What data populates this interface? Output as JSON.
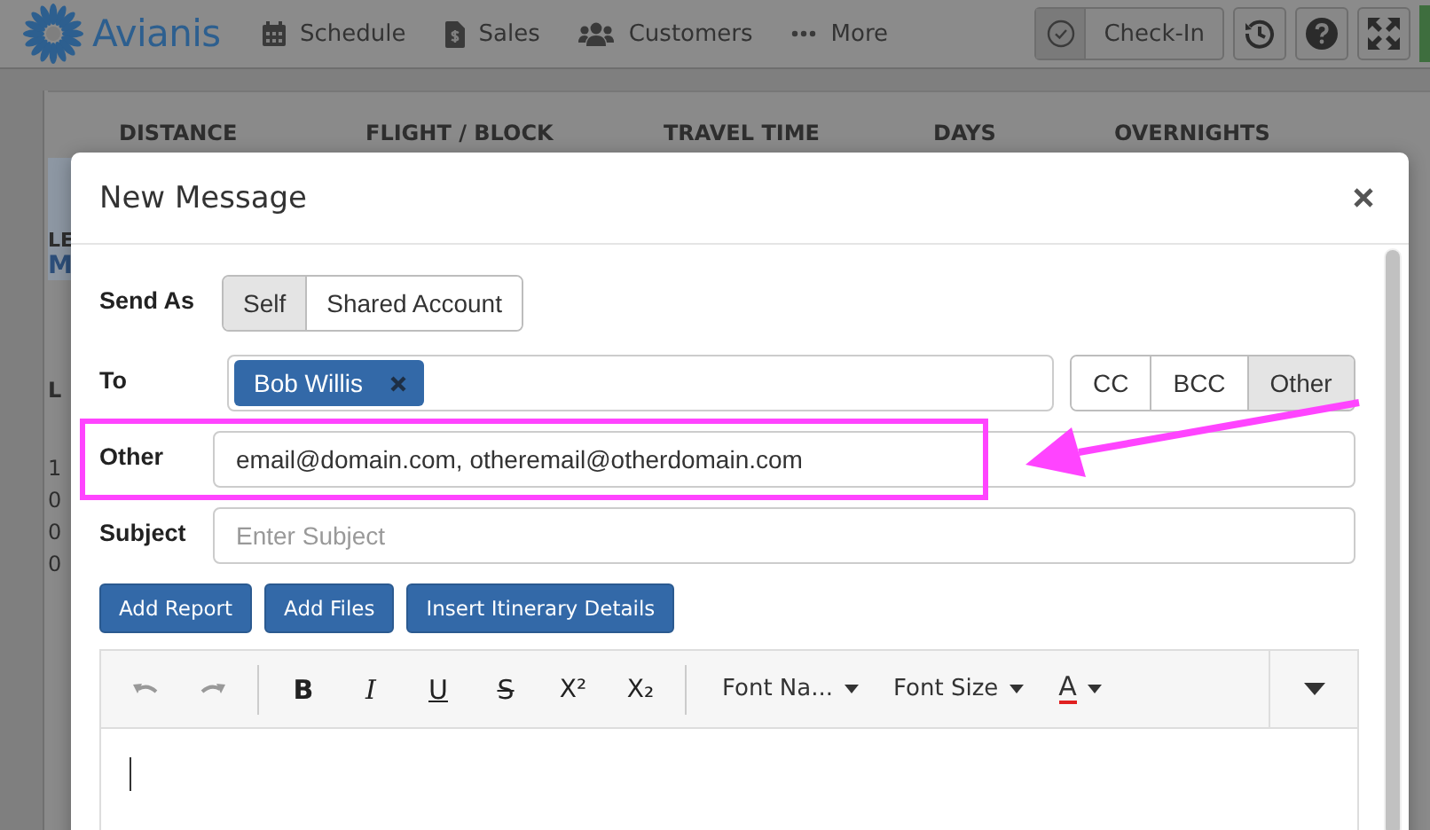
{
  "navbar": {
    "brand": "Avianis",
    "links": [
      "Schedule",
      "Sales",
      "Customers",
      "More"
    ],
    "check_in": "Check-In"
  },
  "background": {
    "columns": [
      "DISTANCE",
      "FLIGHT / BLOCK",
      "TRAVEL TIME",
      "DAYS",
      "OVERNIGHTS"
    ],
    "fragments_top": [
      "LE",
      "M"
    ],
    "fragments_mid": [
      "L"
    ],
    "fragments_low": [
      "1",
      "0",
      "0",
      "0"
    ]
  },
  "dialog": {
    "title": "New Message",
    "send_as": {
      "label": "Send As",
      "options": [
        {
          "label": "Self",
          "selected": true
        },
        {
          "label": "Shared Account",
          "selected": false
        }
      ]
    },
    "to": {
      "label": "To",
      "recipients": [
        "Bob Willis"
      ],
      "modes": [
        {
          "label": "CC",
          "selected": false
        },
        {
          "label": "BCC",
          "selected": false
        },
        {
          "label": "Other",
          "selected": true
        }
      ]
    },
    "other": {
      "label": "Other",
      "value": "email@domain.com, otheremail@otherdomain.com"
    },
    "subject": {
      "label": "Subject",
      "placeholder": "Enter Subject"
    },
    "actions": [
      "Add Report",
      "Add Files",
      "Insert Itinerary Details"
    ],
    "editor": {
      "format_buttons": [
        {
          "label": "B",
          "kind": "bold"
        },
        {
          "label": "I",
          "kind": "italic"
        },
        {
          "label": "U",
          "kind": "underline"
        },
        {
          "label": "S",
          "kind": "strike"
        },
        {
          "label": "X²",
          "kind": "superscript"
        },
        {
          "label": "X₂",
          "kind": "subscript"
        }
      ],
      "font_name": "Font Na...",
      "font_size": "Font Size",
      "color_letter": "A"
    }
  }
}
